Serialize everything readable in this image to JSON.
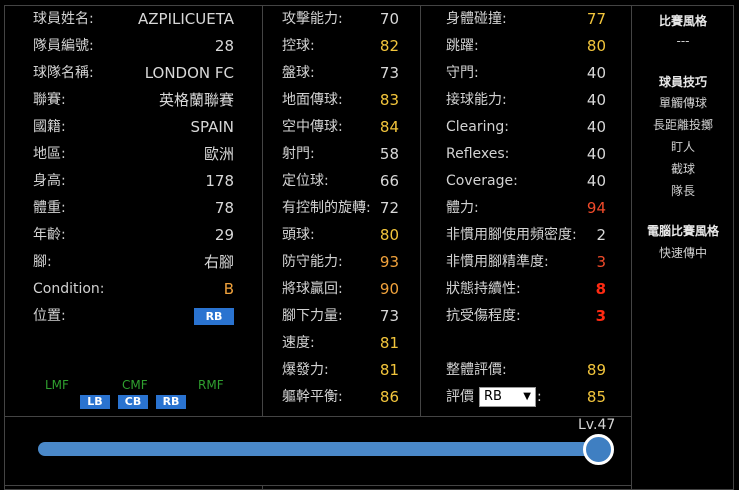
{
  "player": {
    "rows": [
      {
        "label": "球員姓名:",
        "value": "AZPILICUETA",
        "color": "white"
      },
      {
        "label": "隊員編號:",
        "value": "28",
        "color": "white"
      },
      {
        "label": "球隊名稱:",
        "value": "LONDON FC",
        "color": "white"
      },
      {
        "label": "聯賽:",
        "value": "英格蘭聯賽",
        "color": "white"
      },
      {
        "label": "國籍:",
        "value": "SPAIN",
        "color": "white"
      },
      {
        "label": "地區:",
        "value": "歐洲",
        "color": "white"
      },
      {
        "label": "身高:",
        "value": "178",
        "color": "white"
      },
      {
        "label": "體重:",
        "value": "78",
        "color": "white"
      },
      {
        "label": "年齡:",
        "value": "29",
        "color": "white"
      },
      {
        "label": "腳:",
        "value": "右腳",
        "color": "white"
      },
      {
        "label": "Condition:",
        "value": "B",
        "color": "orange"
      }
    ],
    "position_label": "位置:",
    "position_badge": "RB",
    "other_positions": {
      "green_labels": [
        "LMF",
        "CMF",
        "RMF"
      ],
      "blue_badges": [
        "LB",
        "CB",
        "RB"
      ]
    }
  },
  "stats_mid": [
    {
      "label": "攻擊能力:",
      "value": "70",
      "color": "white"
    },
    {
      "label": "控球:",
      "value": "82",
      "color": "yellow"
    },
    {
      "label": "盤球:",
      "value": "73",
      "color": "white"
    },
    {
      "label": "地面傳球:",
      "value": "83",
      "color": "yellow"
    },
    {
      "label": "空中傳球:",
      "value": "84",
      "color": "yellow"
    },
    {
      "label": "射門:",
      "value": "58",
      "color": "white"
    },
    {
      "label": "定位球:",
      "value": "66",
      "color": "white"
    },
    {
      "label": "有控制的旋轉:",
      "value": "72",
      "color": "white"
    },
    {
      "label": "頭球:",
      "value": "80",
      "color": "yellow"
    },
    {
      "label": "防守能力:",
      "value": "93",
      "color": "orange"
    },
    {
      "label": "將球贏回:",
      "value": "90",
      "color": "orange"
    },
    {
      "label": "腳下力量:",
      "value": "73",
      "color": "white"
    },
    {
      "label": "速度:",
      "value": "81",
      "color": "yellow"
    },
    {
      "label": "爆發力:",
      "value": "81",
      "color": "yellow"
    },
    {
      "label": "軀幹平衡:",
      "value": "86",
      "color": "yellow"
    }
  ],
  "stats_right": [
    {
      "label": "身體碰撞:",
      "value": "77",
      "color": "gold"
    },
    {
      "label": "跳躍:",
      "value": "80",
      "color": "yellow"
    },
    {
      "label": "守門:",
      "value": "40",
      "color": "white"
    },
    {
      "label": "接球能力:",
      "value": "40",
      "color": "white"
    },
    {
      "label": "Clearing:",
      "value": "40",
      "color": "white"
    },
    {
      "label": "Reflexes:",
      "value": "40",
      "color": "white"
    },
    {
      "label": "Coverage:",
      "value": "40",
      "color": "white"
    },
    {
      "label": "體力:",
      "value": "94",
      "color": "red"
    },
    {
      "label": "非慣用腳使用頻密度:",
      "value": "2",
      "color": "white"
    },
    {
      "label": "非慣用腳精準度:",
      "value": "3",
      "color": "red"
    },
    {
      "label": "狀態持續性:",
      "value": "8",
      "color": "bred"
    },
    {
      "label": "抗受傷程度:",
      "value": "3",
      "color": "bred"
    }
  ],
  "overall": {
    "label": "整體評價:",
    "value": "89",
    "color": "yellow"
  },
  "rating": {
    "label": "評價",
    "select_value": "RB",
    "colon": ":",
    "value": "85",
    "color": "yellow"
  },
  "side": {
    "match_style_title": "比賽風格",
    "match_style_value": "---",
    "skills_title": "球員技巧",
    "skills": [
      "單觸傳球",
      "長距離投擲",
      "盯人",
      "截球",
      "隊長"
    ],
    "com_style_title": "電腦比賽風格",
    "com_style": [
      "快速傳中"
    ]
  },
  "level": {
    "label": "Lv.47"
  },
  "colors": {
    "blue_badge": "#2a73d0",
    "green_label": "#2f9f2f",
    "slider": "#4a88c8"
  }
}
